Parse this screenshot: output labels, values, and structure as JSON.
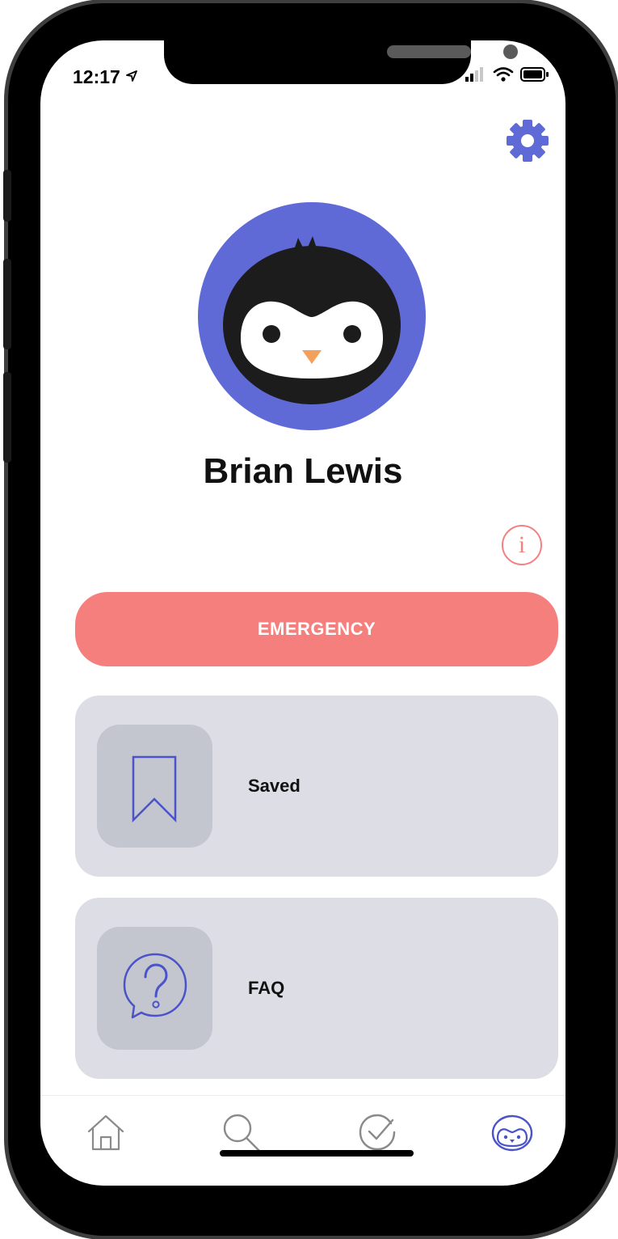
{
  "status_bar": {
    "time": "12:17"
  },
  "profile": {
    "name": "Brian Lewis"
  },
  "emergency_button": {
    "label": "EMERGENCY"
  },
  "menu": {
    "items": [
      {
        "label": "Saved",
        "icon": "bookmark-icon"
      },
      {
        "label": "FAQ",
        "icon": "question-bubble-icon"
      }
    ]
  },
  "tab_bar": {
    "tabs": [
      {
        "icon": "home-icon",
        "active": false
      },
      {
        "icon": "search-icon",
        "active": false
      },
      {
        "icon": "check-circle-icon",
        "active": false
      },
      {
        "icon": "penguin-icon",
        "active": true
      }
    ]
  },
  "colors": {
    "accent": "#5f6ad6",
    "emergency": "#f57f7c",
    "card_bg": "#dddee5",
    "tile_bg": "#c3c5cf",
    "inactive_icon": "#8a8a8a"
  }
}
